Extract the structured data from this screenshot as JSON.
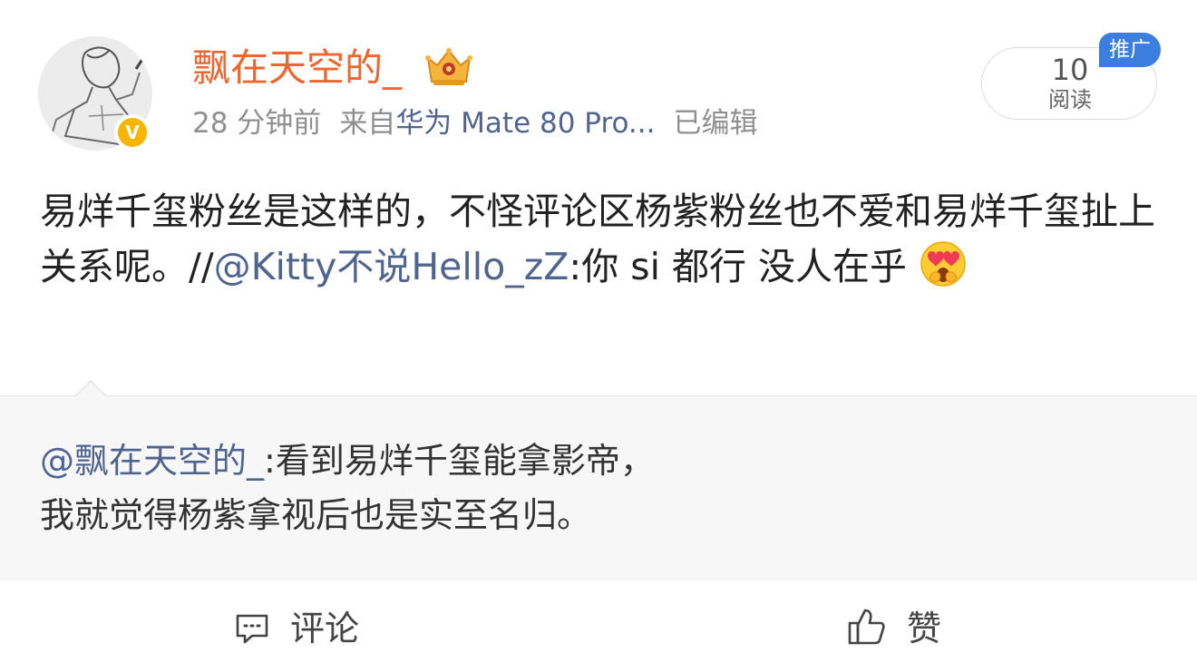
{
  "post": {
    "author": "飘在天空的_",
    "time": "28 分钟前",
    "source_prefix": "来自",
    "source": "华为 Mate 80 Pro...",
    "edited": "已编辑",
    "read_count": "10",
    "read_label": "阅读",
    "promo_tag": "推广",
    "body_text": "易烊千玺粉丝是这样的，不怪评论区杨紫粉丝也不爱和易烊千玺扯上关系呢。//",
    "repost_mention": "@Kitty不说Hello_zZ",
    "repost_text": ":你 si 都行 没人在乎"
  },
  "quote": {
    "mention": "@飘在天空的_",
    "text_line1": ":看到易烊千玺能拿影帝，",
    "text_line2": "我就觉得杨紫拿视后也是实至名归。"
  },
  "footer": {
    "comment_label": "评论",
    "like_label": "赞"
  },
  "icons": {
    "verified": "verified-badge-icon",
    "vip": "vip-crown-icon",
    "emoji": "heart-eyes-emoji-icon",
    "comment": "comment-bubble-icon",
    "like": "thumbs-up-icon"
  },
  "colors": {
    "author_name": "#f0652e",
    "link": "#4f6590",
    "meta_text": "#8f8f8f",
    "promo_tag_bg": "#3b7ee0",
    "verified_badge": "#f7b500",
    "quote_bg": "#f7f7f7"
  }
}
